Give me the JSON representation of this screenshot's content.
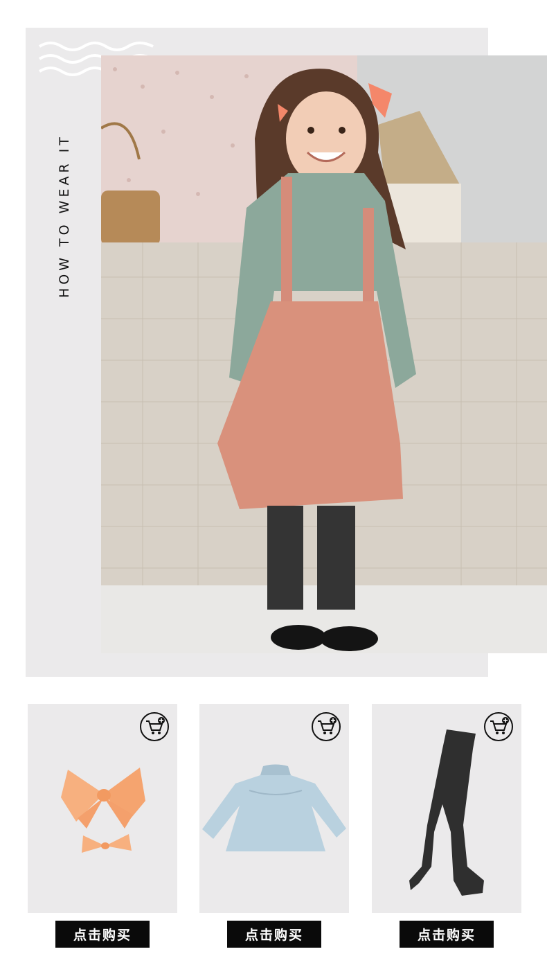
{
  "hero": {
    "side_label": "HOW TO WEAR IT",
    "decor_icon": "wave-lines-icon",
    "photo_alt": "model-outfit-photo"
  },
  "products": [
    {
      "name": "hair-bow",
      "icon": "cart-plus-icon",
      "button_label": "点击购买",
      "color": "#f7b07f"
    },
    {
      "name": "ruffle-blouse",
      "icon": "cart-plus-icon",
      "button_label": "点击购买",
      "color": "#b9d1df"
    },
    {
      "name": "knit-tights",
      "icon": "cart-plus-icon",
      "button_label": "点击购买",
      "color": "#2f2f2f"
    }
  ],
  "colors": {
    "frame_background": "#ebeaeb",
    "button_background": "#0a0a0a",
    "button_text": "#ffffff"
  }
}
